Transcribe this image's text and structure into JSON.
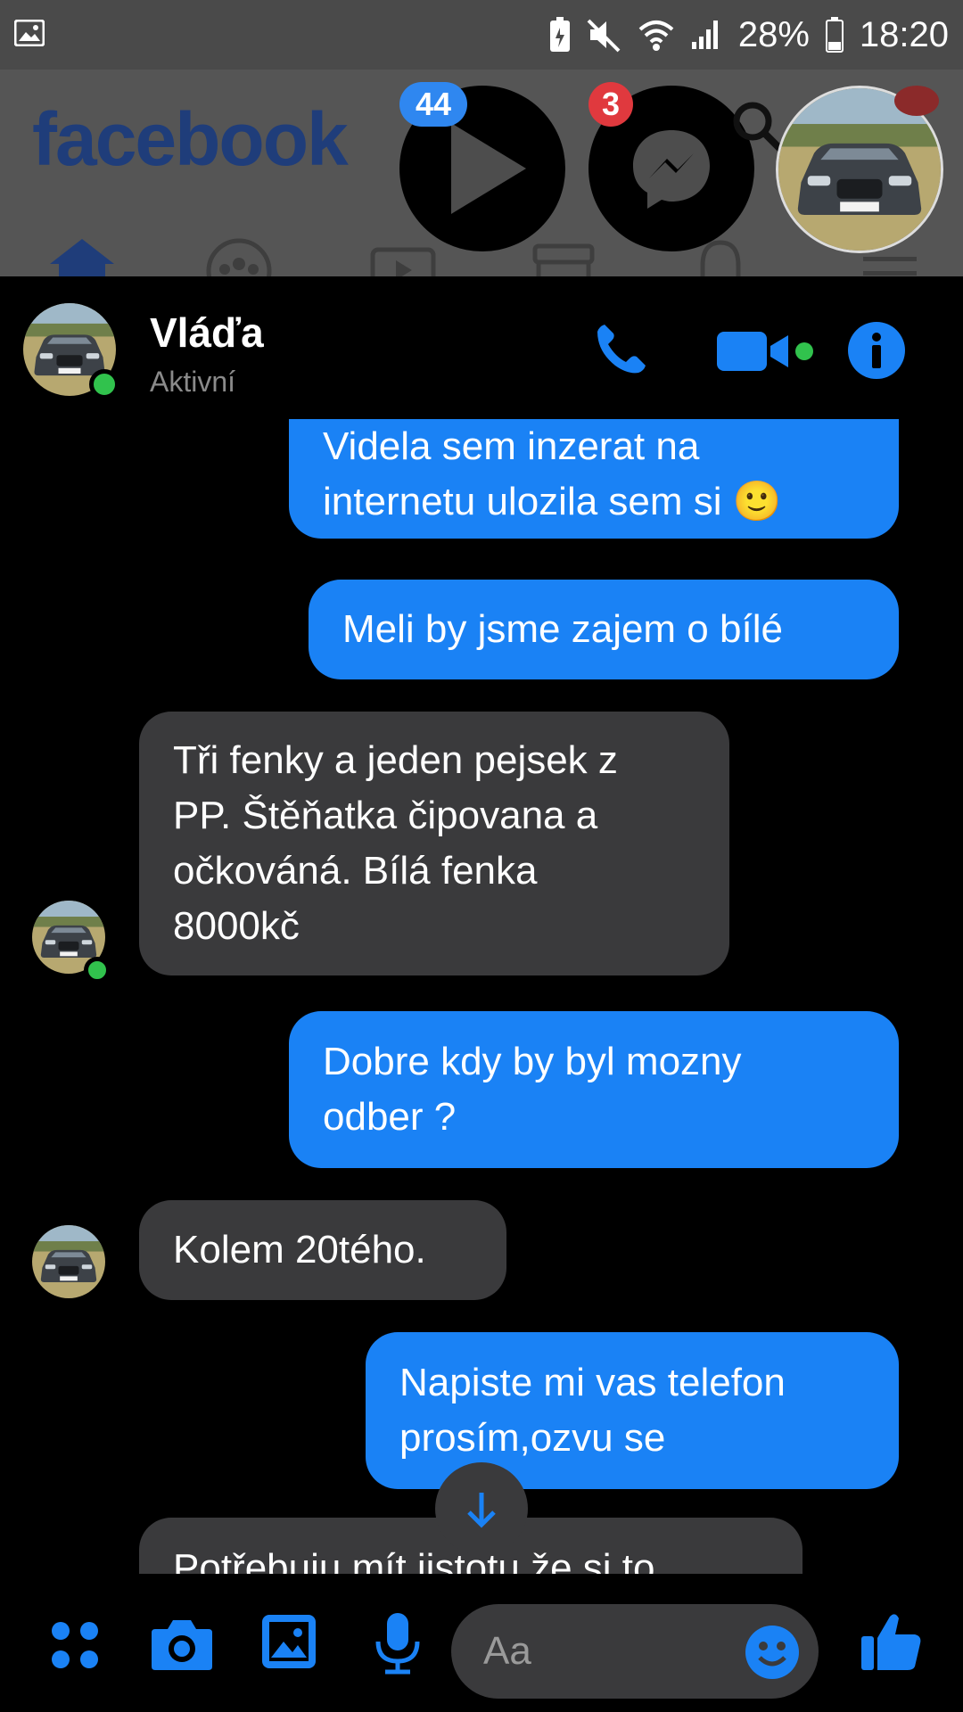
{
  "status_bar": {
    "battery_percent": "28%",
    "time": "18:20",
    "icons": [
      "gallery-icon",
      "battery-saver-icon",
      "mute-icon",
      "wifi-icon",
      "signal-icon",
      "battery-icon"
    ]
  },
  "background_app": {
    "logo": "facebook",
    "tabs": [
      "home-icon",
      "groups-icon",
      "watch-icon",
      "marketplace-icon",
      "notifications-icon",
      "menu-icon"
    ]
  },
  "chat_heads": {
    "video_badge": "44",
    "messenger_badge": "3"
  },
  "chat": {
    "contact_name": "Vláďa",
    "contact_status": "Aktivní",
    "header_actions": [
      "phone-call-icon",
      "video-call-icon",
      "info-icon"
    ],
    "messages": [
      {
        "sender": "me",
        "text": "Videla sem inzerat na\ninternetu ulozila sem si 🙂"
      },
      {
        "sender": "me",
        "text": "Meli by jsme zajem o bílé"
      },
      {
        "sender": "contact",
        "text": "Tři fenky a jeden pejsek z\nPP. Štěňatka čipovana a\nočkováná. Bílá fenka\n8000kč"
      },
      {
        "sender": "me",
        "text": "Dobre kdy by byl mozny\nodber ?"
      },
      {
        "sender": "contact",
        "text": "Kolem 20tého."
      },
      {
        "sender": "me",
        "text": "Napiste mi vas telefon\nprosím,ozvu se"
      },
      {
        "sender": "contact",
        "text": "Potřebuju mít jistotu že si to"
      }
    ]
  },
  "composer": {
    "placeholder": "Aa",
    "icons": [
      "apps-icon",
      "camera-icon",
      "gallery-icon",
      "microphone-icon",
      "emoji-icon",
      "like-icon"
    ]
  },
  "colors": {
    "accent": "#1a82f5",
    "incoming_bubble": "#3a3a3c",
    "online": "#31c24d",
    "badge_blue": "#2f87f0",
    "badge_red": "#e0393e"
  }
}
